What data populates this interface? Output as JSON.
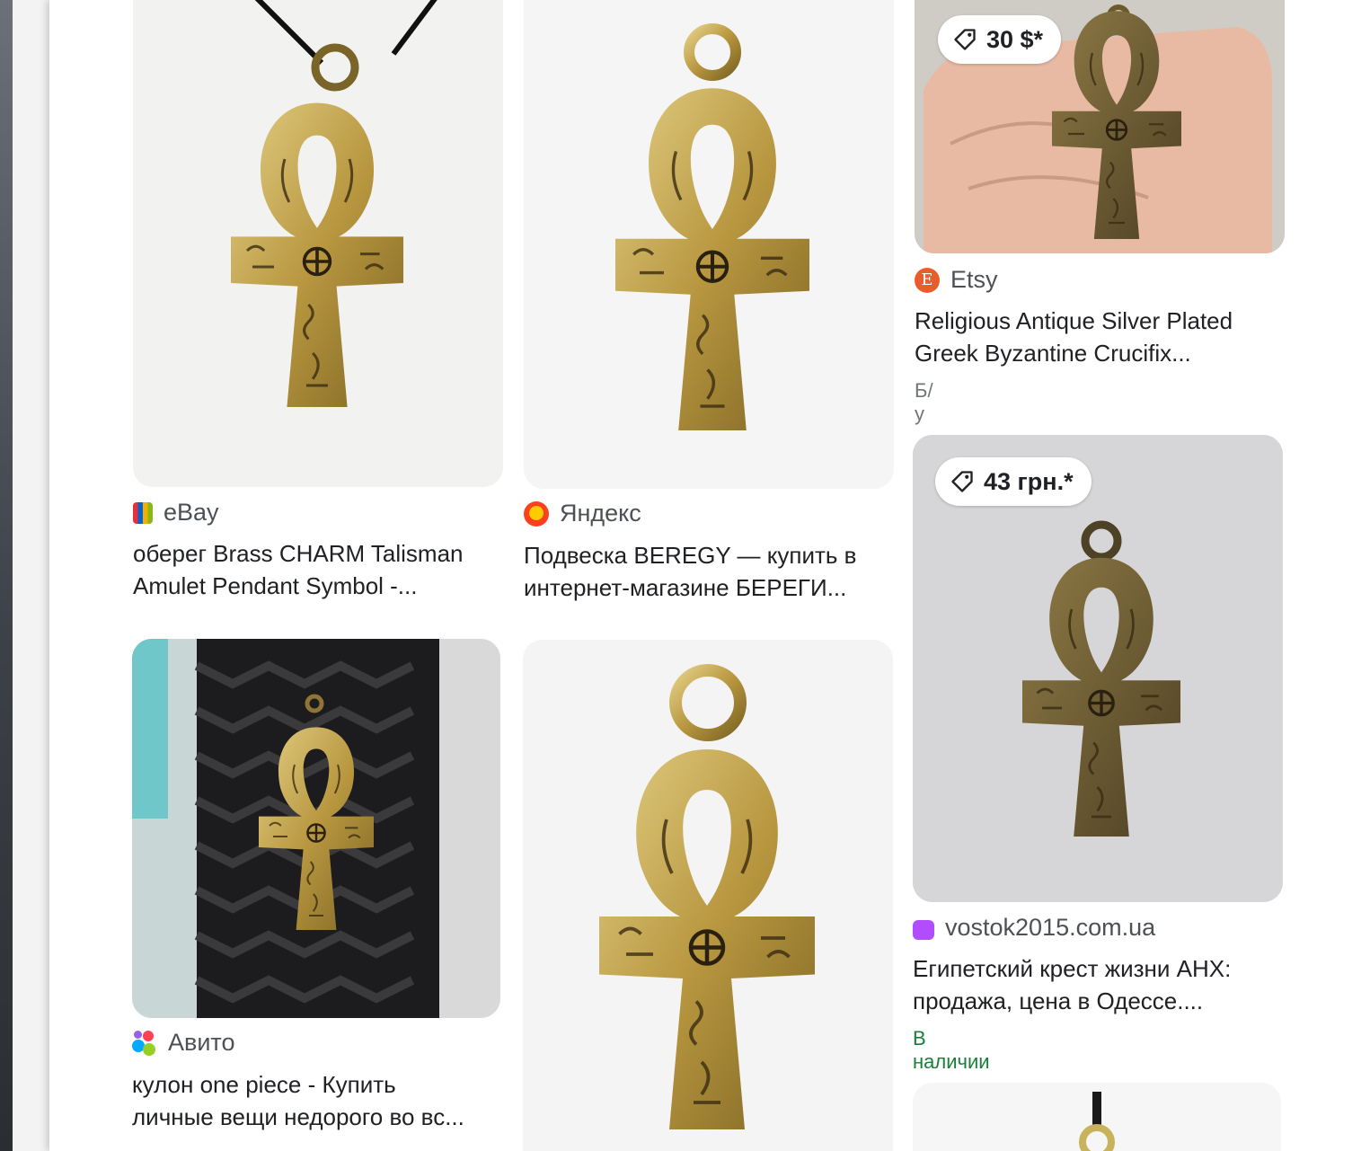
{
  "results": [
    {
      "source": "eBay",
      "title_line1": "оберег Brass CHARM Talisman",
      "title_line2": "Amulet Pendant Symbol -..."
    },
    {
      "source": "Яндекс",
      "title_line1": "Подвеска BEREGY — купить в",
      "title_line2": "интернет-магазине БЕРЕГИ..."
    },
    {
      "source": "Etsy",
      "price": "30 $*",
      "title_line1": "Religious Antique Silver Plated",
      "title_line2": "Greek Byzantine Crucifix...",
      "condition": "Б/у"
    },
    {
      "source": "Авито",
      "title_line1": "кулон one piece - Купить",
      "title_line2": "личные вещи недорого во вс..."
    },
    {
      "source": "",
      "title_line1": "",
      "title_line2": ""
    },
    {
      "source": "vostok2015.com.ua",
      "price": "43 грн.*",
      "title_line1": "Египетский крест жизни АНХ:",
      "title_line2": "продажа, цена в Одессе....",
      "availability": "В наличии"
    }
  ],
  "icons": {
    "price": "price-tag-icon",
    "ebay": "ebay-bag-icon",
    "yandex": "yandex-market-icon",
    "etsy": "etsy-icon",
    "avito": "avito-icon",
    "vostok": "shopping-bag-icon"
  },
  "colors": {
    "availability": "#188038",
    "brass": "#b89a4e"
  }
}
